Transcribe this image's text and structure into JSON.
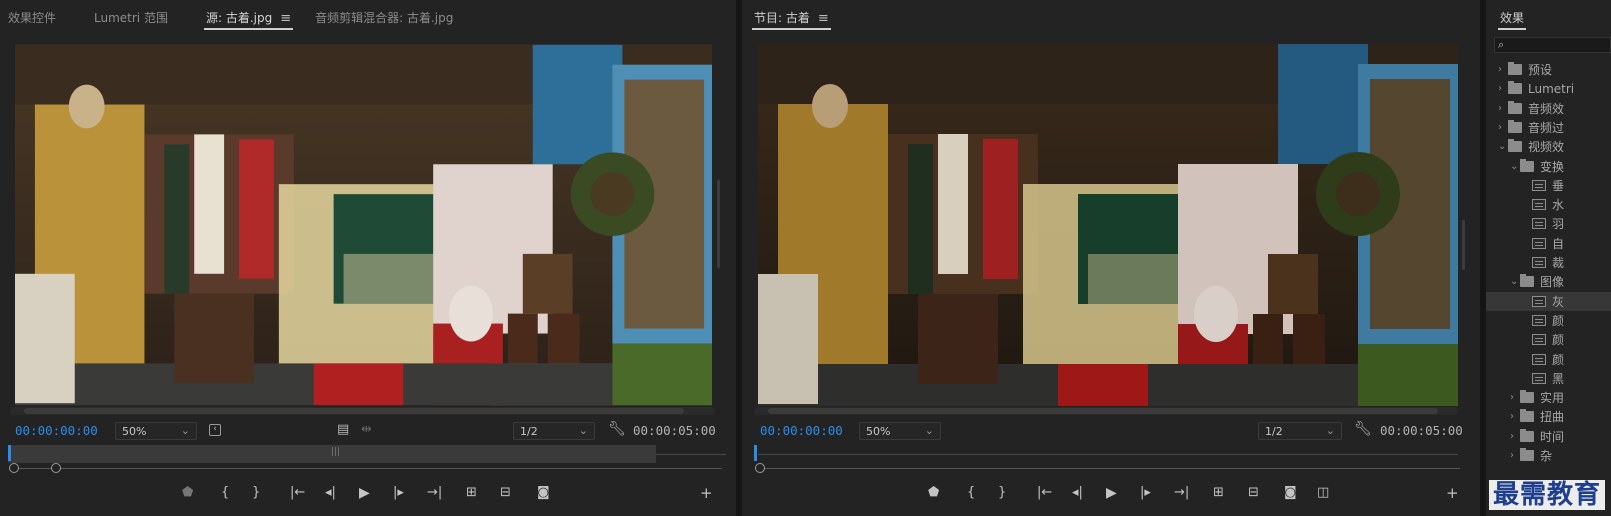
{
  "source": {
    "tabs": [
      {
        "label": "效果控件"
      },
      {
        "label": "Lumetri 范围"
      },
      {
        "label": "源: 古着.jpg",
        "active": true
      },
      {
        "label": "音频剪辑混合器: 古着.jpg"
      }
    ],
    "menu_glyph": "≡",
    "timecode_current": "00:00:00:00",
    "zoom": "50%",
    "resolution": "1/2",
    "timecode_duration": "00:00:05:00"
  },
  "program": {
    "tab_label": "节目: 古着",
    "menu_glyph": "≡",
    "timecode_current": "00:00:00:00",
    "zoom": "50%",
    "resolution": "1/2",
    "timecode_duration": "00:00:05:00"
  },
  "effects": {
    "title": "效果",
    "items": [
      {
        "label": "预设",
        "kind": "folder",
        "depth": 0,
        "arrow": "›"
      },
      {
        "label": "Lumetri",
        "kind": "folder",
        "depth": 0,
        "arrow": "›"
      },
      {
        "label": "音频效",
        "kind": "folder",
        "depth": 0,
        "arrow": "›"
      },
      {
        "label": "音频过",
        "kind": "folder",
        "depth": 0,
        "arrow": "›"
      },
      {
        "label": "视频效",
        "kind": "folder",
        "depth": 0,
        "arrow": "⌄"
      },
      {
        "label": "变换",
        "kind": "folder",
        "depth": 1,
        "arrow": "⌄"
      },
      {
        "label": "垂",
        "kind": "effect",
        "depth": 2
      },
      {
        "label": "水",
        "kind": "effect",
        "depth": 2
      },
      {
        "label": "羽",
        "kind": "effect",
        "depth": 2
      },
      {
        "label": "自",
        "kind": "effect",
        "depth": 2
      },
      {
        "label": "裁",
        "kind": "effect",
        "depth": 2
      },
      {
        "label": "图像",
        "kind": "folder",
        "depth": 1,
        "arrow": "⌄"
      },
      {
        "label": "灰",
        "kind": "effect",
        "depth": 2,
        "selected": true
      },
      {
        "label": "颜",
        "kind": "effect",
        "depth": 2
      },
      {
        "label": "颜",
        "kind": "effect",
        "depth": 2
      },
      {
        "label": "颜",
        "kind": "effect",
        "depth": 2
      },
      {
        "label": "黑",
        "kind": "effect",
        "depth": 2
      },
      {
        "label": "实用",
        "kind": "folder",
        "depth": 1,
        "arrow": "›"
      },
      {
        "label": "扭曲",
        "kind": "folder",
        "depth": 1,
        "arrow": "›"
      },
      {
        "label": "时间",
        "kind": "folder",
        "depth": 1,
        "arrow": "›"
      },
      {
        "label": "杂",
        "kind": "folder",
        "depth": 1,
        "arrow": "›"
      }
    ]
  },
  "watermark": "最需教育",
  "colors": {
    "timecode_blue": "#2d8ceb",
    "panel_bg": "#232323",
    "watermark_blue": "#1e3f8f"
  },
  "icons": [
    "menu-icon",
    "settings-wrench-icon",
    "safe-margins-icon",
    "mark-in-icon",
    "mark-out-icon",
    "go-to-in-icon",
    "step-back-icon",
    "play-icon",
    "step-forward-icon",
    "go-to-out-icon",
    "insert-icon",
    "overwrite-icon",
    "export-frame-icon",
    "add-button-icon",
    "search-icon"
  ]
}
